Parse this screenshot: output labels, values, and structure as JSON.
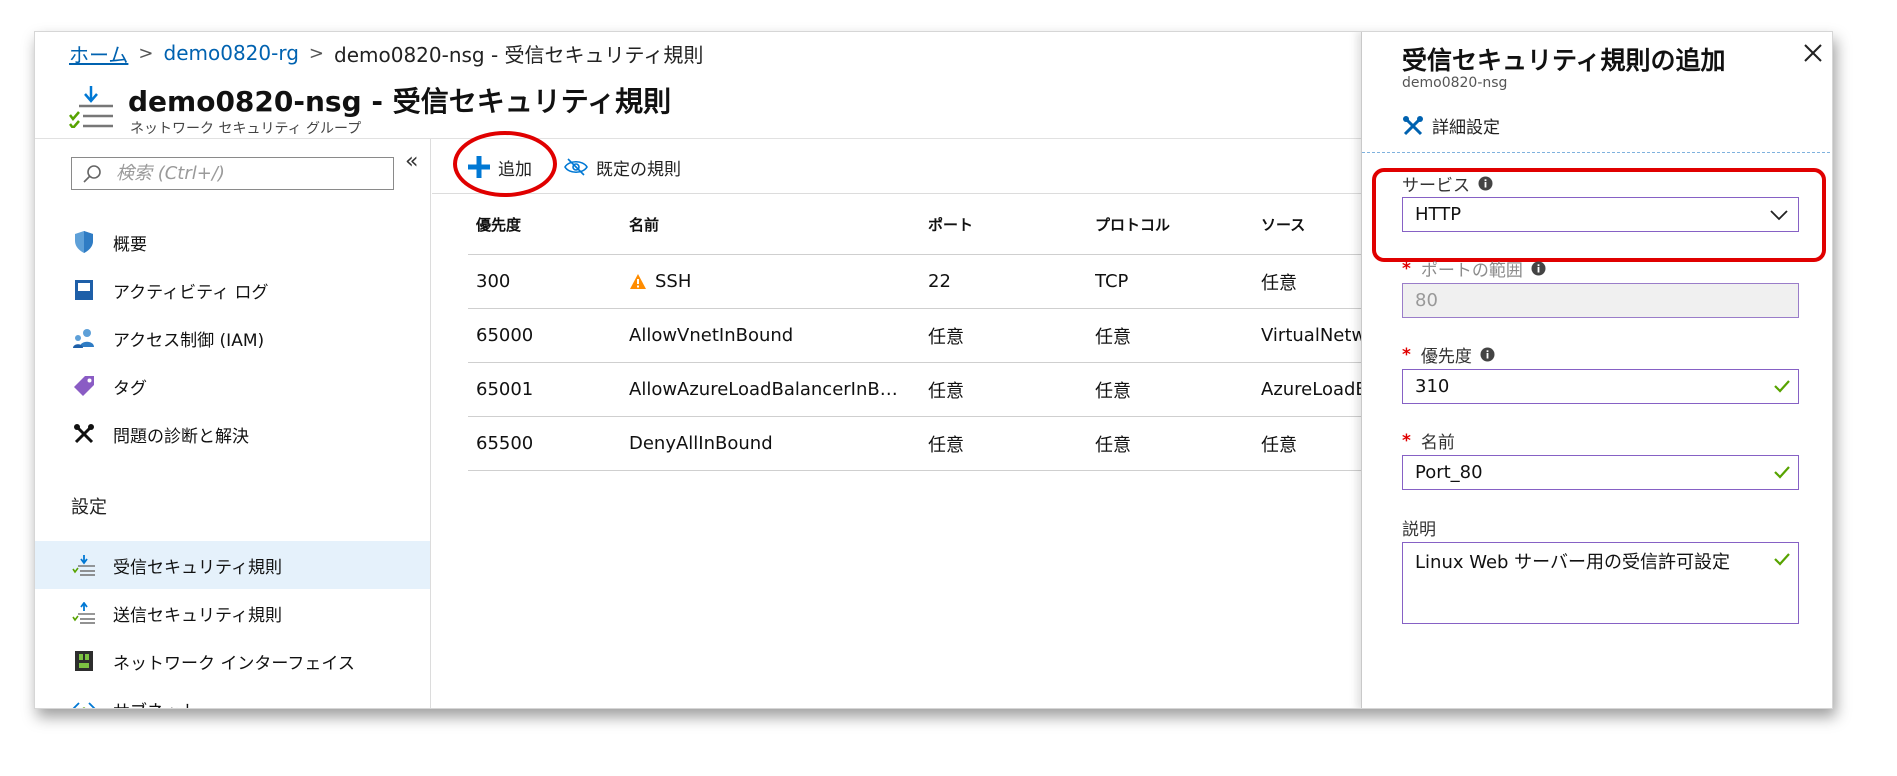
{
  "breadcrumb": {
    "home": "ホーム",
    "rg": "demo0820-rg",
    "current": "demo0820-nsg - 受信セキュリティ規則"
  },
  "header": {
    "title": "demo0820-nsg - 受信セキュリティ規則",
    "subtitle": "ネットワーク セキュリティ グループ"
  },
  "leftnav": {
    "search_placeholder": "検索 (Ctrl+/)",
    "collapse": "«",
    "items": [
      {
        "label": "概要",
        "icon": "shield-icon"
      },
      {
        "label": "アクティビティ ログ",
        "icon": "activity-log-icon"
      },
      {
        "label": "アクセス制御 (IAM)",
        "icon": "people-icon"
      },
      {
        "label": "タグ",
        "icon": "tag-icon"
      },
      {
        "label": "問題の診断と解決",
        "icon": "wrench-icon"
      }
    ],
    "section": "設定",
    "settings_items": [
      {
        "label": "受信セキュリティ規則",
        "icon": "inbound-rules-icon",
        "active": true
      },
      {
        "label": "送信セキュリティ規則",
        "icon": "outbound-rules-icon"
      },
      {
        "label": "ネットワーク インターフェイス",
        "icon": "network-interface-icon"
      },
      {
        "label": "サブネット",
        "icon": "subnet-icon"
      }
    ]
  },
  "toolbar": {
    "add": "追加",
    "default_rules": "既定の規則"
  },
  "table": {
    "headers": [
      "優先度",
      "名前",
      "ポート",
      "プロトコル",
      "ソース"
    ],
    "rows": [
      {
        "priority": "300",
        "name": "SSH",
        "warning": true,
        "port": "22",
        "protocol": "TCP",
        "source": "任意"
      },
      {
        "priority": "65000",
        "name": "AllowVnetInBound",
        "port": "任意",
        "protocol": "任意",
        "source": "VirtualNetwork"
      },
      {
        "priority": "65001",
        "name": "AllowAzureLoadBalancerInB…",
        "port": "任意",
        "protocol": "任意",
        "source": "AzureLoadBalancer"
      },
      {
        "priority": "65500",
        "name": "DenyAllInBound",
        "port": "任意",
        "protocol": "任意",
        "source": "任意"
      }
    ]
  },
  "blade": {
    "title": "受信セキュリティ規則の追加",
    "subtitle": "demo0820-nsg",
    "advanced": "詳細設定",
    "service_label": "サービス",
    "service_value": "HTTP",
    "port_range_label": "ポートの範囲",
    "port_range_value": "80",
    "priority_label": "優先度",
    "priority_value": "310",
    "name_label": "名前",
    "name_value": "Port_80",
    "desc_label": "説明",
    "desc_value": "Linux Web サーバー用の受信許可設定",
    "required_mark": "*"
  },
  "colors": {
    "accent_blue": "#0062b0",
    "field_border": "#8661c5",
    "check_green": "#57a300",
    "highlight_red": "#e00000",
    "active_nav_bg": "#e5f1fb"
  }
}
